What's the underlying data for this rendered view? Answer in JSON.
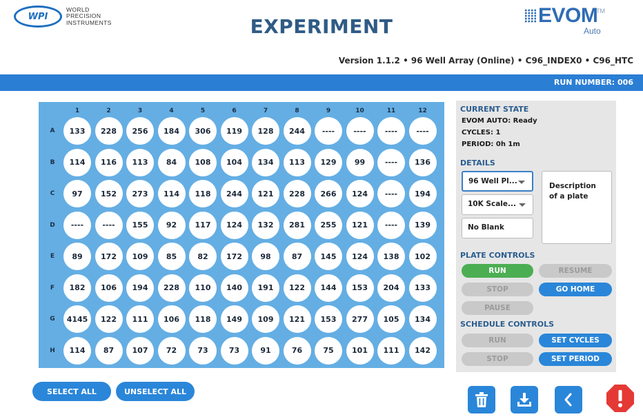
{
  "header": {
    "title": "EXPERIMENT",
    "wpi_logo_text": "WPI",
    "wpi_lines": [
      "WORLD",
      "PRECISION",
      "INSTRUMENTS"
    ],
    "evom_logo": "EVOM",
    "evom_tm": "TM",
    "evom_sub": "Auto",
    "version": "Version 1.1.2 • 96 Well Array (Online) • C96_INDEX0 • C96_HTC"
  },
  "run_bar": {
    "run_number": "RUN NUMBER: 006"
  },
  "plate": {
    "columns": [
      "1",
      "2",
      "3",
      "4",
      "5",
      "6",
      "7",
      "8",
      "9",
      "10",
      "11",
      "12"
    ],
    "rows": [
      {
        "label": "A",
        "values": [
          "133",
          "228",
          "256",
          "184",
          "306",
          "119",
          "128",
          "244",
          "----",
          "----",
          "----",
          "----"
        ]
      },
      {
        "label": "B",
        "values": [
          "114",
          "116",
          "113",
          "84",
          "108",
          "104",
          "134",
          "113",
          "129",
          "99",
          "----",
          "136"
        ]
      },
      {
        "label": "C",
        "values": [
          "97",
          "152",
          "273",
          "114",
          "118",
          "244",
          "121",
          "228",
          "266",
          "124",
          "----",
          "194"
        ]
      },
      {
        "label": "D",
        "values": [
          "----",
          "----",
          "155",
          "92",
          "117",
          "124",
          "132",
          "281",
          "255",
          "121",
          "----",
          "139"
        ]
      },
      {
        "label": "E",
        "values": [
          "89",
          "172",
          "109",
          "85",
          "82",
          "172",
          "98",
          "87",
          "145",
          "124",
          "138",
          "102"
        ]
      },
      {
        "label": "F",
        "values": [
          "182",
          "106",
          "194",
          "228",
          "110",
          "140",
          "191",
          "122",
          "144",
          "153",
          "204",
          "133"
        ]
      },
      {
        "label": "G",
        "values": [
          "4145",
          "122",
          "111",
          "106",
          "118",
          "149",
          "109",
          "121",
          "153",
          "277",
          "105",
          "134"
        ]
      },
      {
        "label": "H",
        "values": [
          "114",
          "87",
          "107",
          "72",
          "73",
          "73",
          "91",
          "76",
          "75",
          "101",
          "111",
          "142"
        ]
      }
    ]
  },
  "side": {
    "current_state_title": "CURRENT STATE",
    "state_line": "EVOM AUTO: Ready",
    "cycles_line": "CYCLES: 1",
    "period_line": "PERIOD: 0h 1m",
    "details_title": "DETAILS",
    "plate_type_select": "96 Well Pl...",
    "scale_select": "10K Scale...",
    "blank_field": "No Blank",
    "description": "Description of a plate",
    "plate_controls_title": "PLATE CONTROLS",
    "run": "RUN",
    "resume": "RESUME",
    "stop": "STOP",
    "go_home": "GO HOME",
    "pause": "PAUSE",
    "schedule_controls_title": "SCHEDULE CONTROLS",
    "sched_run": "RUN",
    "set_cycles": "SET CYCLES",
    "sched_stop": "STOP",
    "set_period": "SET PERIOD"
  },
  "bottom": {
    "select_all": "SELECT ALL",
    "unselect_all": "UNSELECT ALL",
    "icons": [
      "trash-icon",
      "download-icon",
      "back-chevron-icon",
      "alert-stop-icon"
    ]
  },
  "colors": {
    "accent_blue": "#2a86d9",
    "plate_blue": "#64aee4",
    "run_green": "#4cae52",
    "alert_red": "#e53935",
    "title_blue": "#2f5b86"
  }
}
